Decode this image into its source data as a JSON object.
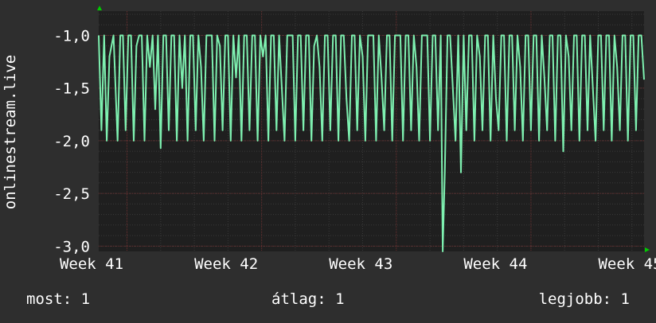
{
  "chart_data": {
    "type": "line",
    "title": "",
    "ylabel": "onlinestream.live",
    "xlabel": "",
    "ylim": [
      -3.05,
      -0.77
    ],
    "xlim": [
      40.79,
      44.84
    ],
    "yticks": [
      {
        "value": -1.0,
        "label": "-1,0"
      },
      {
        "value": -1.5,
        "label": "-1,5"
      },
      {
        "value": -2.0,
        "label": "-2,0"
      },
      {
        "value": -2.5,
        "label": "-2,5"
      },
      {
        "value": -3.0,
        "label": "-3,0"
      }
    ],
    "xticks": [
      {
        "value": 41,
        "label": "Week 41"
      },
      {
        "value": 42,
        "label": "Week 42"
      },
      {
        "value": 43,
        "label": "Week 43"
      },
      {
        "value": 44,
        "label": "Week 44"
      },
      {
        "value": 45,
        "label": "Week 45"
      }
    ],
    "grid": true,
    "series": [
      {
        "color": "#7ef0b0",
        "x": [
          40.79,
          40.81,
          40.83,
          40.85,
          40.87,
          40.9,
          40.93,
          40.95,
          40.97,
          40.99,
          41.01,
          41.03,
          41.05,
          41.07,
          41.09,
          41.11,
          41.13,
          41.15,
          41.17,
          41.19,
          41.21,
          41.23,
          41.25,
          41.27,
          41.29,
          41.31,
          41.33,
          41.35,
          41.37,
          41.39,
          41.41,
          41.43,
          41.45,
          41.47,
          41.49,
          41.51,
          41.53,
          41.55,
          41.57,
          41.59,
          41.61,
          41.63,
          41.65,
          41.67,
          41.69,
          41.71,
          41.73,
          41.75,
          41.77,
          41.79,
          41.81,
          41.83,
          41.85,
          41.87,
          41.89,
          41.91,
          41.93,
          41.95,
          41.97,
          41.99,
          42.01,
          42.03,
          42.05,
          42.07,
          42.09,
          42.11,
          42.13,
          42.15,
          42.17,
          42.19,
          42.21,
          42.23,
          42.25,
          42.27,
          42.29,
          42.31,
          42.33,
          42.35,
          42.37,
          42.39,
          42.41,
          42.43,
          42.45,
          42.47,
          42.49,
          42.51,
          42.53,
          42.55,
          42.57,
          42.59,
          42.61,
          42.63,
          42.65,
          42.67,
          42.69,
          42.71,
          42.73,
          42.75,
          42.77,
          42.79,
          42.81,
          42.83,
          42.85,
          42.87,
          42.89,
          42.91,
          42.93,
          42.95,
          42.97,
          42.99,
          43.01,
          43.03,
          43.05,
          43.07,
          43.09,
          43.11,
          43.13,
          43.15,
          43.17,
          43.19,
          43.21,
          43.23,
          43.25,
          43.27,
          43.29,
          43.31,
          43.33,
          43.345,
          43.36,
          43.38,
          43.4,
          43.42,
          43.44,
          43.46,
          43.48,
          43.5,
          43.52,
          43.54,
          43.56,
          43.58,
          43.6,
          43.62,
          43.64,
          43.66,
          43.68,
          43.7,
          43.72,
          43.74,
          43.76,
          43.78,
          43.8,
          43.82,
          43.84,
          43.86,
          43.88,
          43.9,
          43.92,
          43.94,
          43.96,
          43.98,
          44.0,
          44.02,
          44.04,
          44.06,
          44.08,
          44.1,
          44.12,
          44.14,
          44.16,
          44.18,
          44.2,
          44.22,
          44.24,
          44.26,
          44.28,
          44.3,
          44.32,
          44.34,
          44.36,
          44.38,
          44.4,
          44.42,
          44.44,
          44.46,
          44.48,
          44.5,
          44.52,
          44.54,
          44.56,
          44.58,
          44.6,
          44.62,
          44.64,
          44.66,
          44.68,
          44.7,
          44.72,
          44.74,
          44.76,
          44.78,
          44.8,
          44.82,
          44.84
        ],
        "values": [
          -1.0,
          -1.9,
          -1.0,
          -2.0,
          -1.2,
          -1.0,
          -2.0,
          -1.0,
          -1.0,
          -1.9,
          -1.0,
          -1.0,
          -2.0,
          -1.1,
          -1.0,
          -1.0,
          -2.0,
          -1.0,
          -1.3,
          -1.0,
          -1.7,
          -1.0,
          -2.07,
          -1.0,
          -1.0,
          -1.9,
          -1.0,
          -1.0,
          -2.0,
          -1.0,
          -1.5,
          -1.0,
          -2.0,
          -1.0,
          -1.0,
          -1.9,
          -1.0,
          -1.3,
          -2.0,
          -1.0,
          -1.0,
          -1.0,
          -2.0,
          -1.0,
          -1.1,
          -1.9,
          -1.0,
          -1.0,
          -2.0,
          -1.0,
          -1.4,
          -1.0,
          -2.0,
          -1.0,
          -1.0,
          -1.9,
          -1.0,
          -1.0,
          -2.0,
          -1.0,
          -1.2,
          -1.0,
          -2.0,
          -1.0,
          -1.0,
          -1.9,
          -1.0,
          -1.5,
          -2.0,
          -1.0,
          -1.0,
          -1.0,
          -2.0,
          -1.0,
          -1.0,
          -1.9,
          -1.0,
          -1.0,
          -2.0,
          -1.1,
          -1.0,
          -1.3,
          -2.0,
          -1.0,
          -1.0,
          -1.9,
          -1.0,
          -1.0,
          -2.0,
          -1.0,
          -1.0,
          -1.6,
          -2.0,
          -1.0,
          -1.0,
          -1.9,
          -1.0,
          -1.2,
          -2.0,
          -1.0,
          -1.0,
          -1.0,
          -2.0,
          -1.0,
          -1.4,
          -1.9,
          -1.0,
          -1.0,
          -2.0,
          -1.0,
          -1.0,
          -1.0,
          -2.0,
          -1.0,
          -1.0,
          -1.9,
          -1.0,
          -1.3,
          -2.0,
          -1.0,
          -1.0,
          -1.0,
          -2.0,
          -1.0,
          -1.0,
          -1.9,
          -1.0,
          -3.05,
          -2.3,
          -1.0,
          -1.0,
          -1.5,
          -2.0,
          -1.0,
          -2.3,
          -1.0,
          -1.9,
          -1.0,
          -1.0,
          -2.0,
          -1.0,
          -1.2,
          -1.9,
          -1.0,
          -1.0,
          -2.0,
          -1.0,
          -1.6,
          -1.9,
          -1.0,
          -1.0,
          -2.0,
          -1.0,
          -1.0,
          -1.9,
          -1.0,
          -1.3,
          -2.0,
          -1.0,
          -1.0,
          -1.9,
          -1.0,
          -1.0,
          -2.0,
          -1.0,
          -1.4,
          -1.9,
          -1.0,
          -1.0,
          -2.0,
          -1.0,
          -1.0,
          -2.1,
          -1.0,
          -1.2,
          -1.9,
          -1.0,
          -1.0,
          -2.0,
          -1.0,
          -1.0,
          -1.9,
          -1.0,
          -1.5,
          -2.0,
          -1.0,
          -1.0,
          -1.9,
          -1.0,
          -1.0,
          -2.0,
          -1.0,
          -1.3,
          -1.9,
          -1.0,
          -1.0,
          -2.0,
          -1.0,
          -1.0,
          -1.9,
          -1.0,
          -1.0,
          -1.42
        ]
      }
    ]
  },
  "legend": {
    "current": "most: 1",
    "average": "átlag: 1",
    "max": "legjobb: 1"
  },
  "colors": {
    "background": "#2e2e2e",
    "plot_background": "#1f1f1f",
    "line": "#7ef0b0",
    "grid_major": "#6b3030",
    "grid_minor": "#3a3a3a",
    "text": "#ffffff",
    "axis_arrow": "#00cc00"
  }
}
